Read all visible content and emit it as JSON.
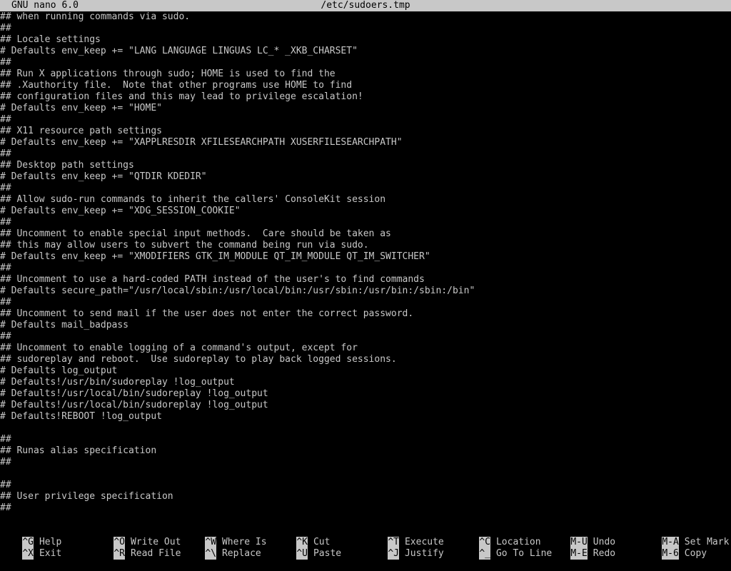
{
  "title_bar": {
    "app_name": "GNU nano 6.0",
    "file_name": "/etc/sudoers.tmp"
  },
  "editor": {
    "lines": [
      "## when running commands via sudo.",
      "##",
      "## Locale settings",
      "# Defaults env_keep += \"LANG LANGUAGE LINGUAS LC_* _XKB_CHARSET\"",
      "##",
      "## Run X applications through sudo; HOME is used to find the",
      "## .Xauthority file.  Note that other programs use HOME to find",
      "## configuration files and this may lead to privilege escalation!",
      "# Defaults env_keep += \"HOME\"",
      "##",
      "## X11 resource path settings",
      "# Defaults env_keep += \"XAPPLRESDIR XFILESEARCHPATH XUSERFILESEARCHPATH\"",
      "##",
      "## Desktop path settings",
      "# Defaults env_keep += \"QTDIR KDEDIR\"",
      "##",
      "## Allow sudo-run commands to inherit the callers' ConsoleKit session",
      "# Defaults env_keep += \"XDG_SESSION_COOKIE\"",
      "##",
      "## Uncomment to enable special input methods.  Care should be taken as",
      "## this may allow users to subvert the command being run via sudo.",
      "# Defaults env_keep += \"XMODIFIERS GTK_IM_MODULE QT_IM_MODULE QT_IM_SWITCHER\"",
      "##",
      "## Uncomment to use a hard-coded PATH instead of the user's to find commands",
      "# Defaults secure_path=\"/usr/local/sbin:/usr/local/bin:/usr/sbin:/usr/bin:/sbin:/bin\"",
      "##",
      "## Uncomment to send mail if the user does not enter the correct password.",
      "# Defaults mail_badpass",
      "##",
      "## Uncomment to enable logging of a command's output, except for",
      "## sudoreplay and reboot.  Use sudoreplay to play back logged sessions.",
      "# Defaults log_output",
      "# Defaults!/usr/bin/sudoreplay !log_output",
      "# Defaults!/usr/local/bin/sudoreplay !log_output",
      "# Defaults!/usr/local/bin/sudoreplay !log_output",
      "# Defaults!REBOOT !log_output",
      "",
      "##",
      "## Runas alias specification",
      "##",
      "",
      "##",
      "## User privilege specification",
      "##"
    ]
  },
  "shortcuts": {
    "row1": [
      {
        "key": "^G",
        "label": "Help"
      },
      {
        "key": "^O",
        "label": "Write Out"
      },
      {
        "key": "^W",
        "label": "Where Is"
      },
      {
        "key": "^K",
        "label": "Cut"
      },
      {
        "key": "^T",
        "label": "Execute"
      },
      {
        "key": "^C",
        "label": "Location"
      },
      {
        "key": "M-U",
        "label": "Undo"
      },
      {
        "key": "M-A",
        "label": "Set Mark"
      }
    ],
    "row2": [
      {
        "key": "^X",
        "label": "Exit"
      },
      {
        "key": "^R",
        "label": "Read File"
      },
      {
        "key": "^\\",
        "label": "Replace"
      },
      {
        "key": "^U",
        "label": "Paste"
      },
      {
        "key": "^J",
        "label": "Justify"
      },
      {
        "key": "^_",
        "label": "Go To Line"
      },
      {
        "key": "M-E",
        "label": "Redo"
      },
      {
        "key": "M-6",
        "label": "Copy"
      }
    ]
  },
  "colors": {
    "background": "#000000",
    "text": "#c8c8c8",
    "inverse_bg": "#c8c8c8",
    "inverse_fg": "#000000"
  }
}
